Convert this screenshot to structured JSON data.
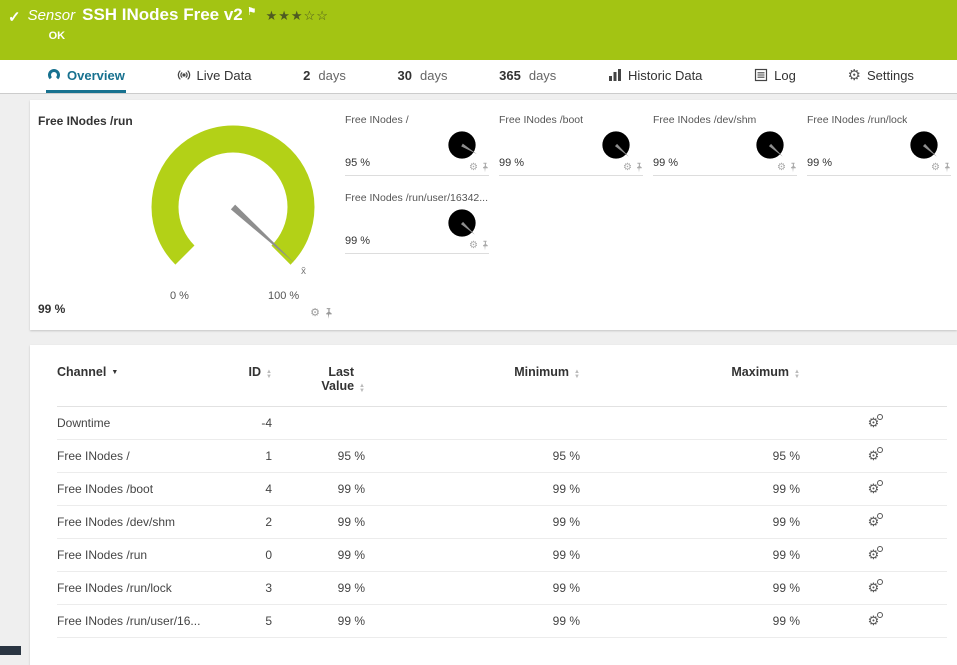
{
  "colors": {
    "banner_green": "#a3c413",
    "gauge_green": "#b3d117",
    "active_tab_blue": "#17718f"
  },
  "icons": {
    "check": "✓",
    "flag": "⚑",
    "gear": "⚙",
    "sort_up": "▲",
    "sort_down": "▼",
    "caret_down": "▼"
  },
  "header": {
    "kind": "Sensor",
    "title": "SSH INodes Free v2",
    "stars": "★★★☆☆",
    "status": "OK"
  },
  "tabs": {
    "overview": "Overview",
    "live_data": "Live Data",
    "d2_num": "2",
    "d2_label": "days",
    "d30_num": "30",
    "d30_label": "days",
    "d365_num": "365",
    "d365_label": "days",
    "historic": "Historic Data",
    "log": "Log",
    "settings": "Settings"
  },
  "gauges": {
    "main": {
      "title": "Free INodes /run",
      "value": "99 %",
      "percent": 99,
      "scale_min": "0 %",
      "scale_max": "100 %",
      "marker": "x̄"
    },
    "small": [
      {
        "title": "Free INodes /",
        "value": "95 %",
        "percent": 95
      },
      {
        "title": "Free INodes /boot",
        "value": "99 %",
        "percent": 99
      },
      {
        "title": "Free INodes /dev/shm",
        "value": "99 %",
        "percent": 99
      },
      {
        "title": "Free INodes /run/lock",
        "value": "99 %",
        "percent": 99
      },
      {
        "title": "Free INodes /run/user/16342...",
        "value": "99 %",
        "percent": 99
      }
    ]
  },
  "table": {
    "headers": {
      "channel": "Channel",
      "id": "ID",
      "last_value": "Last Value",
      "minimum": "Minimum",
      "maximum": "Maximum"
    },
    "rows": [
      {
        "channel": "Downtime",
        "id": "-4",
        "last": "",
        "min": "",
        "max": ""
      },
      {
        "channel": "Free INodes /",
        "id": "1",
        "last": "95 %",
        "min": "95 %",
        "max": "95 %"
      },
      {
        "channel": "Free INodes /boot",
        "id": "4",
        "last": "99 %",
        "min": "99 %",
        "max": "99 %"
      },
      {
        "channel": "Free INodes /dev/shm",
        "id": "2",
        "last": "99 %",
        "min": "99 %",
        "max": "99 %"
      },
      {
        "channel": "Free INodes /run",
        "id": "0",
        "last": "99 %",
        "min": "99 %",
        "max": "99 %"
      },
      {
        "channel": "Free INodes /run/lock",
        "id": "3",
        "last": "99 %",
        "min": "99 %",
        "max": "99 %"
      },
      {
        "channel": "Free INodes /run/user/16...",
        "id": "5",
        "last": "99 %",
        "min": "99 %",
        "max": "99 %"
      }
    ]
  }
}
